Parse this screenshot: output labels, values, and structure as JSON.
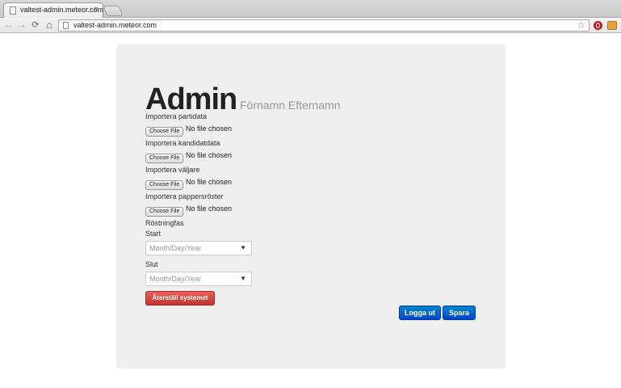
{
  "browser": {
    "tab_title": "valtest-admin.meteor.com",
    "tab_close": "×",
    "url": "valtest-admin.meteor.com",
    "back_icon": "←",
    "forward_icon": "→",
    "reload_icon": "⟳",
    "home_icon": "⌂",
    "star_icon": "☆"
  },
  "page": {
    "title": "Admin",
    "subtitle": "Förnamn Efternamn",
    "imports": [
      {
        "label": "Importera partidata",
        "button": "Choose File",
        "status": "No file chosen"
      },
      {
        "label": "Importera kandidatdata",
        "button": "Choose File",
        "status": "No file chosen"
      },
      {
        "label": "Importera väljare",
        "button": "Choose File",
        "status": "No file chosen"
      },
      {
        "label": "Importera pappersröster",
        "button": "Choose File",
        "status": "No file chosen"
      }
    ],
    "voting_phase": {
      "label": "Röstningfas",
      "start_label": "Start",
      "start_placeholder": "Month/Day/Year",
      "end_label": "Slut",
      "end_placeholder": "Month/Day/Year",
      "arrow": "▼"
    },
    "reset_button": "Återställ systemet",
    "logout_button": "Logga ut",
    "save_button": "Spara"
  },
  "colors": {
    "danger": "#da4f49",
    "primary": "#0066cc",
    "panel": "#efefef"
  }
}
